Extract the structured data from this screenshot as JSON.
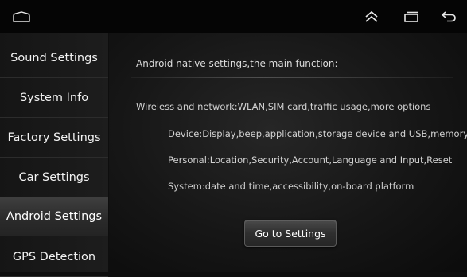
{
  "topbar": {
    "icons": [
      "home-icon",
      "chevron-up-double-icon",
      "recent-apps-icon",
      "back-icon"
    ]
  },
  "sidebar": {
    "items": [
      {
        "label": "Sound Settings"
      },
      {
        "label": "System Info"
      },
      {
        "label": "Factory Settings"
      },
      {
        "label": "Car Settings"
      },
      {
        "label": "Android Settings",
        "active": true
      },
      {
        "label": "GPS Detection"
      }
    ]
  },
  "main": {
    "intro": "Android native settings,the main function:",
    "lines": [
      "Wireless and network:WLAN,SIM card,traffic usage,more options",
      "Device:Display,beep,application,storage device and USB,memory",
      "Personal:Location,Security,Account,Language and Input,Reset",
      "System:date and time,accessibility,on-board platform"
    ],
    "button_label": "Go to Settings"
  },
  "colors": {
    "background": "#0e0e0e",
    "sidebar": "#1a1a1a",
    "active_item": "#3a3a3a",
    "text": "#f2f2f2"
  }
}
